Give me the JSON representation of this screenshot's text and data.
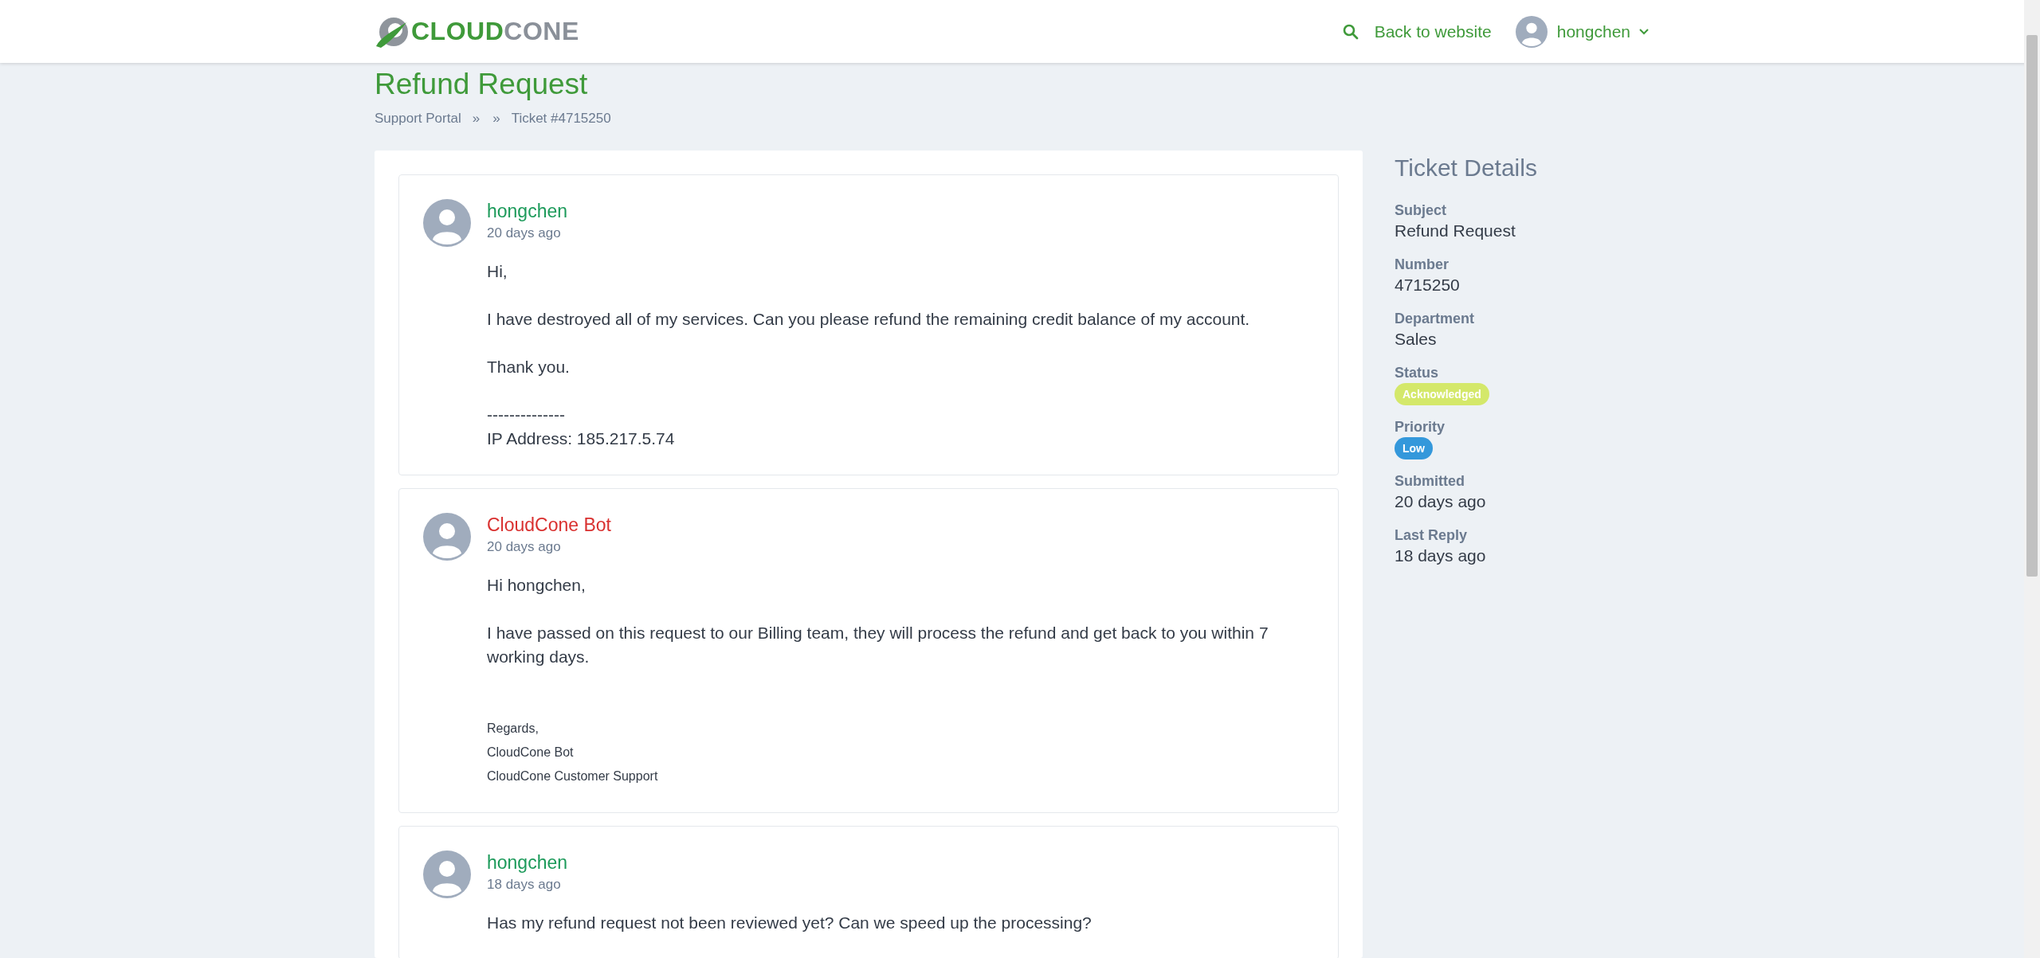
{
  "header": {
    "logo": {
      "parts": [
        "CLOUD",
        "CONE"
      ]
    },
    "back_link": "Back to website",
    "user": "hongchen"
  },
  "page": {
    "title": "Refund Request",
    "breadcrumb": [
      "Support Portal",
      "»",
      "»",
      "Ticket #4715250"
    ]
  },
  "messages": [
    {
      "author": "hongchen",
      "kind": "client",
      "time": "20 days ago",
      "paragraphs": [
        [
          "Hi,"
        ],
        [
          "I have destroyed all of my services. Can you please refund the remaining credit balance of my account."
        ],
        [
          "Thank you."
        ],
        [
          "--------------",
          "IP Address: 185.217.5.74"
        ]
      ]
    },
    {
      "author": "CloudCone Bot",
      "kind": "staff",
      "time": "20 days ago",
      "paragraphs": [
        [
          "Hi hongchen,"
        ],
        [
          "I have passed on this request to our Billing team, they will process the refund and get back to you within 7 working days."
        ]
      ],
      "signature": [
        "Regards,",
        "CloudCone Bot",
        "CloudCone Customer Support"
      ]
    },
    {
      "author": "hongchen",
      "kind": "client",
      "time": "18 days ago",
      "paragraphs": [
        [
          "Has my refund request not been reviewed yet? Can we speed up the processing?"
        ]
      ]
    }
  ],
  "details": {
    "title": "Ticket Details",
    "fields": [
      {
        "label": "Subject",
        "kind": "text",
        "value": "Refund Request"
      },
      {
        "label": "Number",
        "kind": "text",
        "value": "4715250"
      },
      {
        "label": "Department",
        "kind": "text",
        "value": "Sales"
      },
      {
        "label": "Status",
        "kind": "badge",
        "value": "Acknowledged",
        "color": "#d4e86a"
      },
      {
        "label": "Priority",
        "kind": "badge",
        "value": "Low",
        "color": "#3498db"
      },
      {
        "label": "Submitted",
        "kind": "text",
        "value": "20 days ago"
      },
      {
        "label": "Last Reply",
        "kind": "text",
        "value": "18 days ago"
      }
    ]
  }
}
